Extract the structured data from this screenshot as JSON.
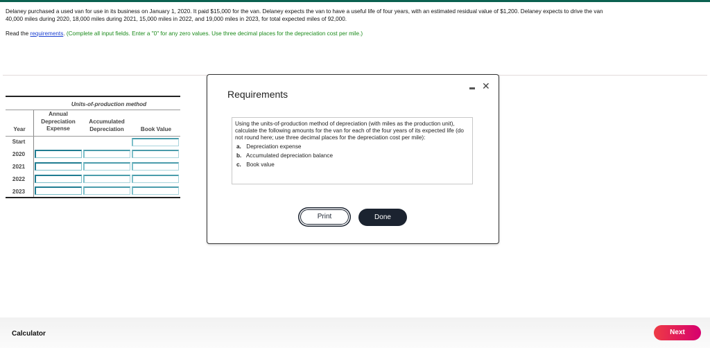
{
  "problem": {
    "line1": "Delaney purchased a used van for use in its business on January 1, 2020. It paid $15,000 for the van. Delaney expects the van to have a useful life of four years, with an estimated residual value of $1,200. Delaney expects to drive the van",
    "line2": "40,000 miles during 2020, 18,000 miles during 2021, 15,000 miles in 2022, and 19,000 miles in 2023, for total expected miles of 92,000."
  },
  "instructions": {
    "prefix": "Read the ",
    "link": "requirements",
    "suffix": ". ",
    "note": "(Complete all input fields. Enter a \"0\" for any zero values. Use three decimal places for the depreciation cost per mile.)"
  },
  "table": {
    "title": "Units-of-production method",
    "headers": {
      "year": "Year",
      "annual_line1": "Annual",
      "annual_line2": "Depreciation",
      "annual_line3": "Expense",
      "accum_line1": "Accumulated",
      "accum_line2": "Depreciation",
      "book": "Book Value"
    },
    "rows": [
      {
        "year": "Start",
        "annual": "",
        "accumulated": "",
        "book": ""
      },
      {
        "year": "2020",
        "annual": "",
        "accumulated": "",
        "book": ""
      },
      {
        "year": "2021",
        "annual": "",
        "accumulated": "",
        "book": ""
      },
      {
        "year": "2022",
        "annual": "",
        "accumulated": "",
        "book": ""
      },
      {
        "year": "2023",
        "annual": "",
        "accumulated": "",
        "book": ""
      }
    ]
  },
  "modal": {
    "title": "Requirements",
    "minimize_icon": "minimize-icon",
    "close_icon": "close-icon",
    "close_glyph": "✕",
    "body": "Using the units-of-production method of depreciation (with miles as the production unit), calculate the following amounts for the van for each of the four years of its expected life (do not round here; use three decimal places for the depreciation cost per mile):",
    "items": [
      {
        "letter": "a.",
        "text": "Depreciation expense"
      },
      {
        "letter": "b.",
        "text": "Accumulated depreciation balance"
      },
      {
        "letter": "c.",
        "text": "Book value"
      }
    ],
    "print_label": "Print",
    "done_label": "Done"
  },
  "footer": {
    "calculator_label": "Calculator",
    "next_label": "Next"
  },
  "colors": {
    "topbar": "#0b6150",
    "link": "#1a3fd1",
    "instruction_note": "#1a8a1a",
    "input_border": "#1f7c91",
    "done_button": "#1b2330",
    "next_gradient_start": "#ee3b45",
    "next_gradient_end": "#d6006e"
  }
}
